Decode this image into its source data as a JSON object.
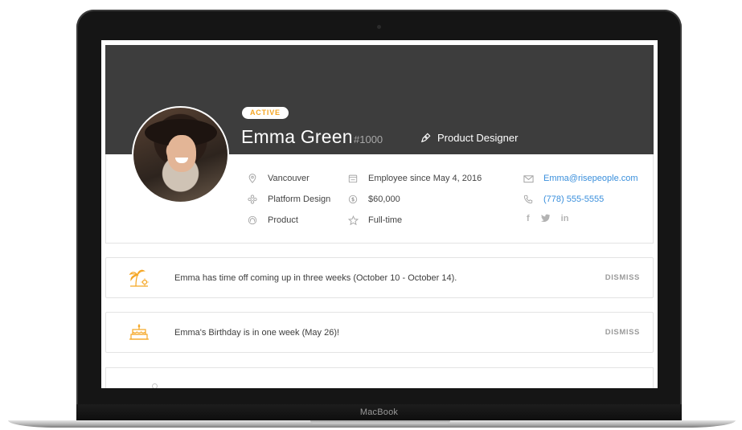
{
  "laptop": {
    "brand_label": "MacBook"
  },
  "profile": {
    "status": "ACTIVE",
    "name": "Emma Green",
    "employee_id": "#1000",
    "role": "Product Designer",
    "details": {
      "location": "Vancouver",
      "team": "Platform Design",
      "department": "Product",
      "employment_start": "Employee since May 4, 2016",
      "salary": "$60,000",
      "employment_type": "Full-time",
      "email": "Emma@risepeople.com",
      "phone": "(778) 555-5555"
    },
    "social": [
      "f",
      "in"
    ]
  },
  "notices": [
    {
      "message": "Emma has time off coming up in three weeks (October 10 - October 14).",
      "action": "DISMISS"
    },
    {
      "message": "Emma's Birthday is in one week (May 26)!",
      "action": "DISMISS"
    }
  ],
  "colors": {
    "accent": "#f5a623",
    "hero_bg": "#3d3d3d",
    "link": "#3a8fdc"
  },
  "icons": [
    "location-icon",
    "team-icon",
    "department-icon",
    "calendar-icon",
    "salary-icon",
    "star-icon",
    "mail-icon",
    "phone-icon",
    "facebook-icon",
    "twitter-icon",
    "linkedin-icon",
    "palm-tree-icon",
    "birthday-cake-icon",
    "pen-icon"
  ]
}
